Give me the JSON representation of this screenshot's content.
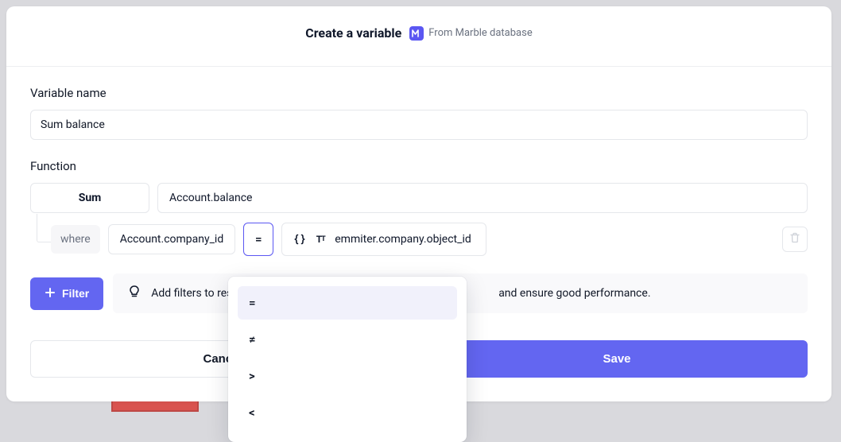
{
  "header": {
    "title": "Create a variable",
    "badge_text": "From Marble database",
    "badge_icon_label": "M"
  },
  "variable_name": {
    "label": "Variable name",
    "value": "Sum balance"
  },
  "function": {
    "label": "Function",
    "aggregator": "Sum",
    "field": "Account.balance"
  },
  "where": {
    "label": "where",
    "left": "Account.company_id",
    "operator": "=",
    "right": "emmiter.company.object_id"
  },
  "filter": {
    "button": "Filter",
    "hint_prefix": "Add filters to res",
    "hint_suffix": "and ensure good performance."
  },
  "footer": {
    "cancel": "Cance",
    "save": "Save"
  },
  "operator_dropdown": {
    "items": [
      "=",
      "≠",
      ">",
      "<"
    ],
    "active_index": 0
  }
}
